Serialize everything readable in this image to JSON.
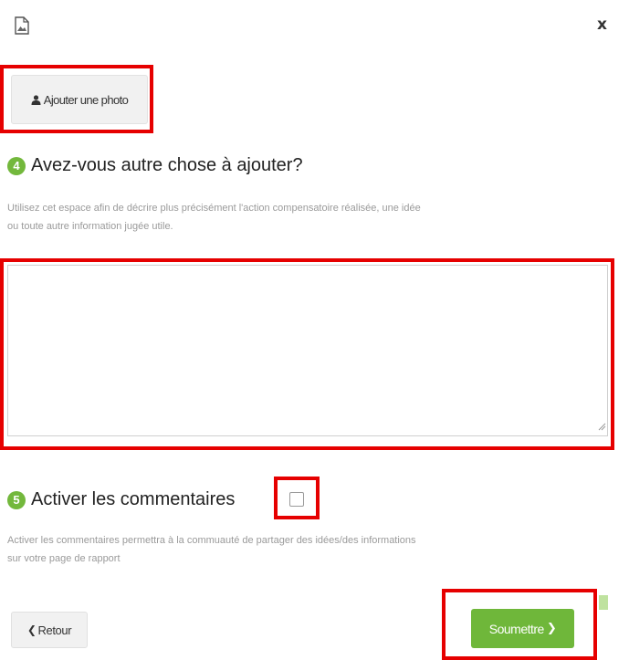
{
  "header": {
    "close_label": "x"
  },
  "photo": {
    "button_label": "Ajouter une photo"
  },
  "step4": {
    "number": "4",
    "title": "Avez-vous autre chose à ajouter?",
    "help_line1": "Utilisez cet espace afin de décrire plus précisément l'action compensatoire réalisée, une idée",
    "help_line2": "ou toute autre information jugée utile."
  },
  "comment_field": {
    "value": "",
    "placeholder": ""
  },
  "step5": {
    "number": "5",
    "title": "Activer les commentaires",
    "checked": false,
    "help_line1": "Activer les commentaires permettra à la commuauté de partager des idées/des informations",
    "help_line2": "sur votre page de rapport"
  },
  "footer": {
    "back_label": "Retour",
    "submit_label": "Soumettre"
  },
  "colors": {
    "accent_green": "#6fb73a",
    "highlight_red": "#e60000"
  }
}
